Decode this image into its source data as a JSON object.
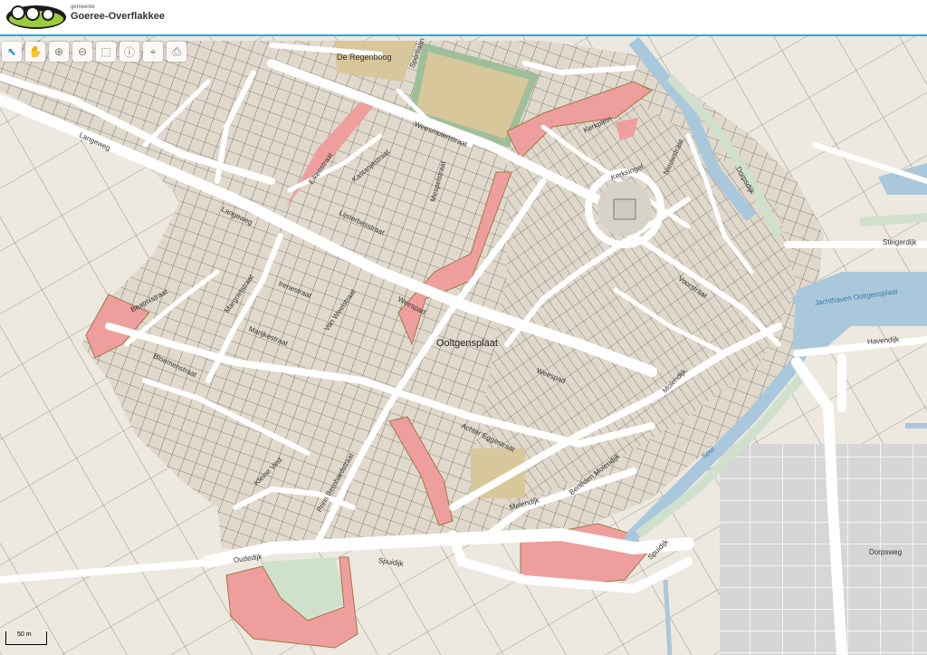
{
  "header": {
    "logo_small": "gemeente",
    "logo_name": "Goeree-Overflakkee"
  },
  "toolbar": {
    "tools": [
      {
        "icon": "cursor-select-icon",
        "glyph": "⬉"
      },
      {
        "icon": "pan-hand-icon",
        "glyph": "✋"
      },
      {
        "icon": "zoom-in-icon",
        "glyph": "⊕"
      },
      {
        "icon": "zoom-out-icon",
        "glyph": "⊖"
      },
      {
        "icon": "zoom-extent-icon",
        "glyph": "⬚"
      },
      {
        "icon": "identify-icon",
        "glyph": "ⓘ"
      },
      {
        "icon": "location-icon",
        "glyph": "⌖"
      },
      {
        "icon": "print-icon",
        "glyph": "⎙"
      }
    ]
  },
  "map": {
    "labels": {
      "regenboog": "De Regenboog",
      "sportlaan": "Sportlaan",
      "langeweg1": "Langeweg",
      "langeweg2": "Langeweg",
      "weesmolenstraat": "Weesmolenstraat",
      "kerkplein": "Kerkplein",
      "kerksingel": "Kerksingel",
      "nieuwstraat": "Nieuwstraat",
      "dorpsdijk": "Dorpsdijk",
      "eikenstraat": "Eikenstraat",
      "kastanjestraat": "Kastanjestraat",
      "lijsterbesstraat": "Lijsterbesstraat",
      "mespelstraat": "Mespelstraat",
      "steigerdijk": "Steigerdijk",
      "jachthaven": "Jachthaven Ooltgensplaat",
      "havendijk": "Havendijk",
      "irenestraat": "Irenestraat",
      "weespad1": "Weespad",
      "ooltgensplaat": "Ooltgensplaat",
      "voorstraat": "Voorstraat",
      "van_weelstraat": "Van Weelstraat",
      "margrietstraat": "Margrietstraat",
      "marijkestraat": "Marijkestraat",
      "beatrixstraat": "Beatrixstraat",
      "bloemenstraat": "Bloemenstraat",
      "weespad2": "Weespad",
      "molendijk1": "Molendijk",
      "spui": "Spui",
      "kleine_vest": "Kleine Vest",
      "oudedijk": "Oudedijk",
      "spuidijk1": "Spuidijk",
      "spuidijk2": "Spuidijk",
      "molendijk2": "Molendijk",
      "dorpsweg": "Dorpsweg",
      "beneden_molendijk": "Beneden Molendijk",
      "prins_bernhardstraat": "Prins Bernhardstraat",
      "achterweg": "Achter Eggestraat"
    }
  },
  "scale": {
    "label": "50 m"
  },
  "colors": {
    "accent": "#27a9e1",
    "built": "#e0d9cc",
    "road": "#ffffff",
    "water": "#aac8dc",
    "green": "#cfe1cc",
    "pink": "#ef9e9e",
    "sport": "#d8c79a"
  }
}
